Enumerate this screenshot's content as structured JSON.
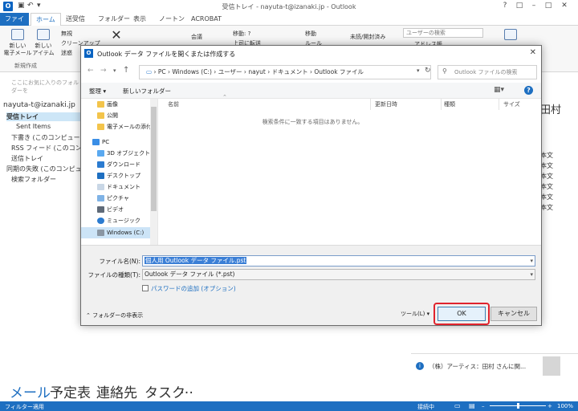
{
  "window": {
    "title": "受信トレイ - nayuta-t@izanaki.jp - Outlook",
    "logo": "O",
    "controls": [
      "?",
      "□",
      "–",
      "□",
      "✕"
    ]
  },
  "ribbon": {
    "tabs": [
      "ファイル",
      "ホーム",
      "送受信",
      "フォルダー",
      "表示",
      "ノートン",
      "ACROBAT"
    ],
    "active_tab": "ホーム",
    "buttons": {
      "new_mail": "新しい\n電子メール",
      "new_item": "新しい\nアイテム",
      "ignore": "無視",
      "cleanup": "クリーンアップ",
      "junk": "迷惑",
      "meeting": "会議",
      "move_to": "移動: ?",
      "to_boss": "上司に転送",
      "move": "移動",
      "rules": "ルール",
      "unread_read": "未読/開封済み",
      "search_user_placeholder": "ユーザーの検索",
      "address_book": "アドレス帳"
    },
    "group_new": "新規作成"
  },
  "sidebar": {
    "search_placeholder": "ここにお気に入りのフォルダーを",
    "account": "nayuta-t@izanaki.jp",
    "items": [
      "受信トレイ",
      "Sent Items",
      "下書き (このコンピューターの",
      "RSS フィード (このコンピュー",
      "送信トレイ",
      "同期の失敗 (このコンピュー",
      "検索フォルダー"
    ]
  },
  "reading_pane": {
    "name": "田村",
    "lines": [
      "本文",
      "本文",
      "本文",
      "本文",
      "本文",
      "本文"
    ],
    "notification": "（株）アーティス：田村 さんに関..."
  },
  "bottom_nav": [
    "メール",
    "予定表",
    "連絡先",
    "タスク",
    "…"
  ],
  "status": {
    "left": "フィルター適用",
    "connection": "接続中",
    "zoom": "100%"
  },
  "dialog": {
    "title": "Outlook データ ファイルを開くまたは作成する",
    "breadcrumb": [
      "PC",
      "Windows (C:)",
      "ユーザー",
      "nayut",
      "ドキュメント",
      "Outlook ファイル"
    ],
    "search_placeholder": "Outlook ファイルの検索",
    "toolbar": {
      "organize": "整理 ▾",
      "new_folder": "新しいフォルダー"
    },
    "tree": [
      {
        "label": "画像",
        "icon": "folder-icon"
      },
      {
        "label": "公開",
        "icon": "folder-icon"
      },
      {
        "label": "電子メールの添付",
        "icon": "folder-icon"
      },
      {
        "label": "PC",
        "icon": "pc-icon"
      },
      {
        "label": "3D オブジェクト",
        "icon": "3d-objects-icon"
      },
      {
        "label": "ダウンロード",
        "icon": "download-icon"
      },
      {
        "label": "デスクトップ",
        "icon": "desktop-icon"
      },
      {
        "label": "ドキュメント",
        "icon": "documents-icon"
      },
      {
        "label": "ピクチャ",
        "icon": "pictures-icon"
      },
      {
        "label": "ビデオ",
        "icon": "video-icon"
      },
      {
        "label": "ミュージック",
        "icon": "music-icon"
      },
      {
        "label": "Windows (C:)",
        "icon": "drive-icon"
      }
    ],
    "columns": [
      "名前",
      "更新日時",
      "種類",
      "サイズ"
    ],
    "empty_message": "検索条件に一致する項目はありません。",
    "file_name_label": "ファイル名(N):",
    "file_name_value": "個人用 Outlook データ ファイル.pst",
    "file_type_label": "ファイルの種類(T):",
    "file_type_value": "Outlook データ ファイル (*.pst)",
    "password_label": "パスワードの追加 (オプション)",
    "hide_folders": "フォルダーの非表示",
    "tools": "ツール(L)",
    "ok": "OK",
    "cancel": "キャンセル"
  }
}
